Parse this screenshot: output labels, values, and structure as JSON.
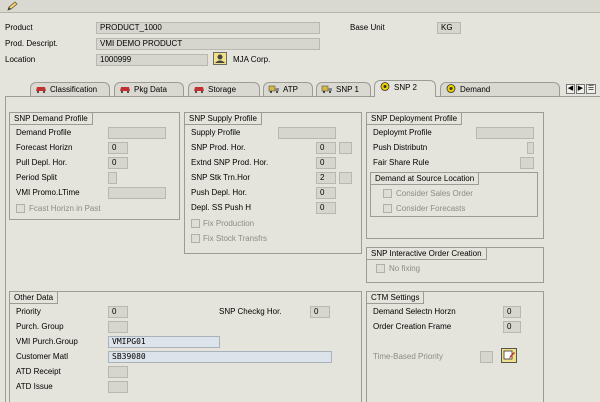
{
  "toolbar": {
    "edit_icon": "pencil-icon"
  },
  "header": {
    "product_label": "Product",
    "product_value": "PRODUCT_1000",
    "base_unit_label": "Base Unit",
    "base_unit_value": "KG",
    "desc_label": "Prod. Descript.",
    "desc_value": "VMI DEMO PRODUCT",
    "location_label": "Location",
    "location_value": "1000999",
    "location_name": "MJA Corp."
  },
  "tabs": [
    {
      "label": "Classification",
      "icon": "car-icon"
    },
    {
      "label": "Pkg Data",
      "icon": "car-icon"
    },
    {
      "label": "Storage",
      "icon": "car-icon"
    },
    {
      "label": "ATP",
      "icon": "truck-icon"
    },
    {
      "label": "SNP 1",
      "icon": "truck-icon"
    },
    {
      "label": "SNP 2",
      "icon": "status-icon"
    },
    {
      "label": "Demand",
      "icon": "status-icon"
    }
  ],
  "snp_demand": {
    "title": "SNP Demand Profile",
    "demand_profile": "Demand Profile",
    "forecast_horizon": "Forecast Horizn",
    "forecast_horizon_value": "0",
    "pull_depl": "Pull Depl. Hor.",
    "pull_depl_value": "0",
    "period_split": "Period Split",
    "vmi_promo": "VMI Promo.LTime",
    "fcast_past": "Fcast Horizn in Past"
  },
  "snp_supply": {
    "title": "SNP Supply Profile",
    "supply_profile": "Supply Profile",
    "prod_hor": "SNP Prod. Hor.",
    "prod_hor_value": "0",
    "extnd_prod_hor": "Extnd SNP Prod. Hor.",
    "extnd_prod_hor_value": "0",
    "stk_trn_hor": "SNP Stk Trn.Hor",
    "stk_trn_hor_value": "2",
    "push_depl": "Push Depl. Hor.",
    "push_depl_value": "0",
    "depl_ss_push": "Depl. SS Push H",
    "depl_ss_push_value": "0",
    "fix_production": "Fix Production",
    "fix_stock": "Fix Stock Transfrs"
  },
  "snp_deploy": {
    "title": "SNP Deployment Profile",
    "deploy_profile": "Deploymt Profile",
    "push_distrib": "Push Distributn",
    "fair_share": "Fair Share Rule",
    "demand_source_title": "Demand at Source Location",
    "consider_sales": "Consider Sales Order",
    "consider_forecasts": "Consider Forecasts"
  },
  "snp_interactive": {
    "title": "SNP Interactive Order Creation",
    "no_fixing": "No fixing"
  },
  "other_data": {
    "title": "Other Data",
    "priority": "Priority",
    "priority_value": "0",
    "checkg_hor": "SNP Checkg Hor.",
    "checkg_hor_value": "0",
    "purch_group": "Purch. Group",
    "vmi_purch_group": "VMI Purch.Group",
    "vmi_purch_group_value": "VMIPG01",
    "customer_matl": "Customer Matl",
    "customer_matl_value": "SB39080",
    "atd_receipt": "ATD Receipt",
    "atd_issue": "ATD Issue"
  },
  "ctm": {
    "title": "CTM Settings",
    "demand_selectn": "Demand Selectn Horzn",
    "demand_selectn_value": "0",
    "order_creation": "Order Creation Frame",
    "order_creation_value": "0",
    "time_based": "Time-Based Priority"
  }
}
